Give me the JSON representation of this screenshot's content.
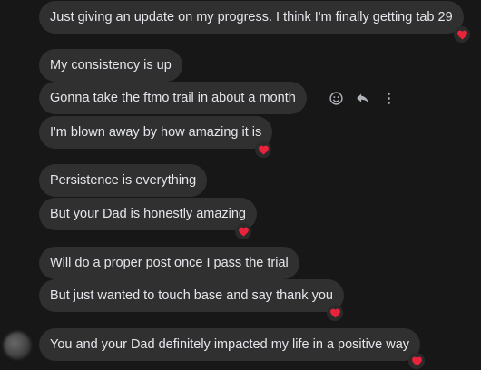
{
  "messages": [
    {
      "text": "Just giving an update on my progress. I think I'm finally getting tab 29",
      "reaction": "heart"
    },
    {
      "text": "My consistency is up",
      "reaction": null
    },
    {
      "text": "Gonna take the ftmo trail in about a month",
      "reaction": null
    },
    {
      "text": "I'm blown away by how amazing it is",
      "reaction": "heart"
    },
    {
      "text": "Persistence is everything",
      "reaction": null
    },
    {
      "text": "But your Dad is honestly amazing",
      "reaction": "heart"
    },
    {
      "text": "Will do a proper post once I pass the trial",
      "reaction": null
    },
    {
      "text": "But just wanted to touch base and say thank you",
      "reaction": "heart"
    },
    {
      "text": "You and your Dad definitely impacted my life in a positive way",
      "reaction": "heart"
    }
  ],
  "hover_actions": [
    "emoji-icon",
    "reply-icon",
    "more-options-icon"
  ],
  "colors": {
    "background": "#171717",
    "bubble": "#303030",
    "text": "#e4e6eb",
    "heart": "#e8233c",
    "icon": "#b0b3b8"
  }
}
